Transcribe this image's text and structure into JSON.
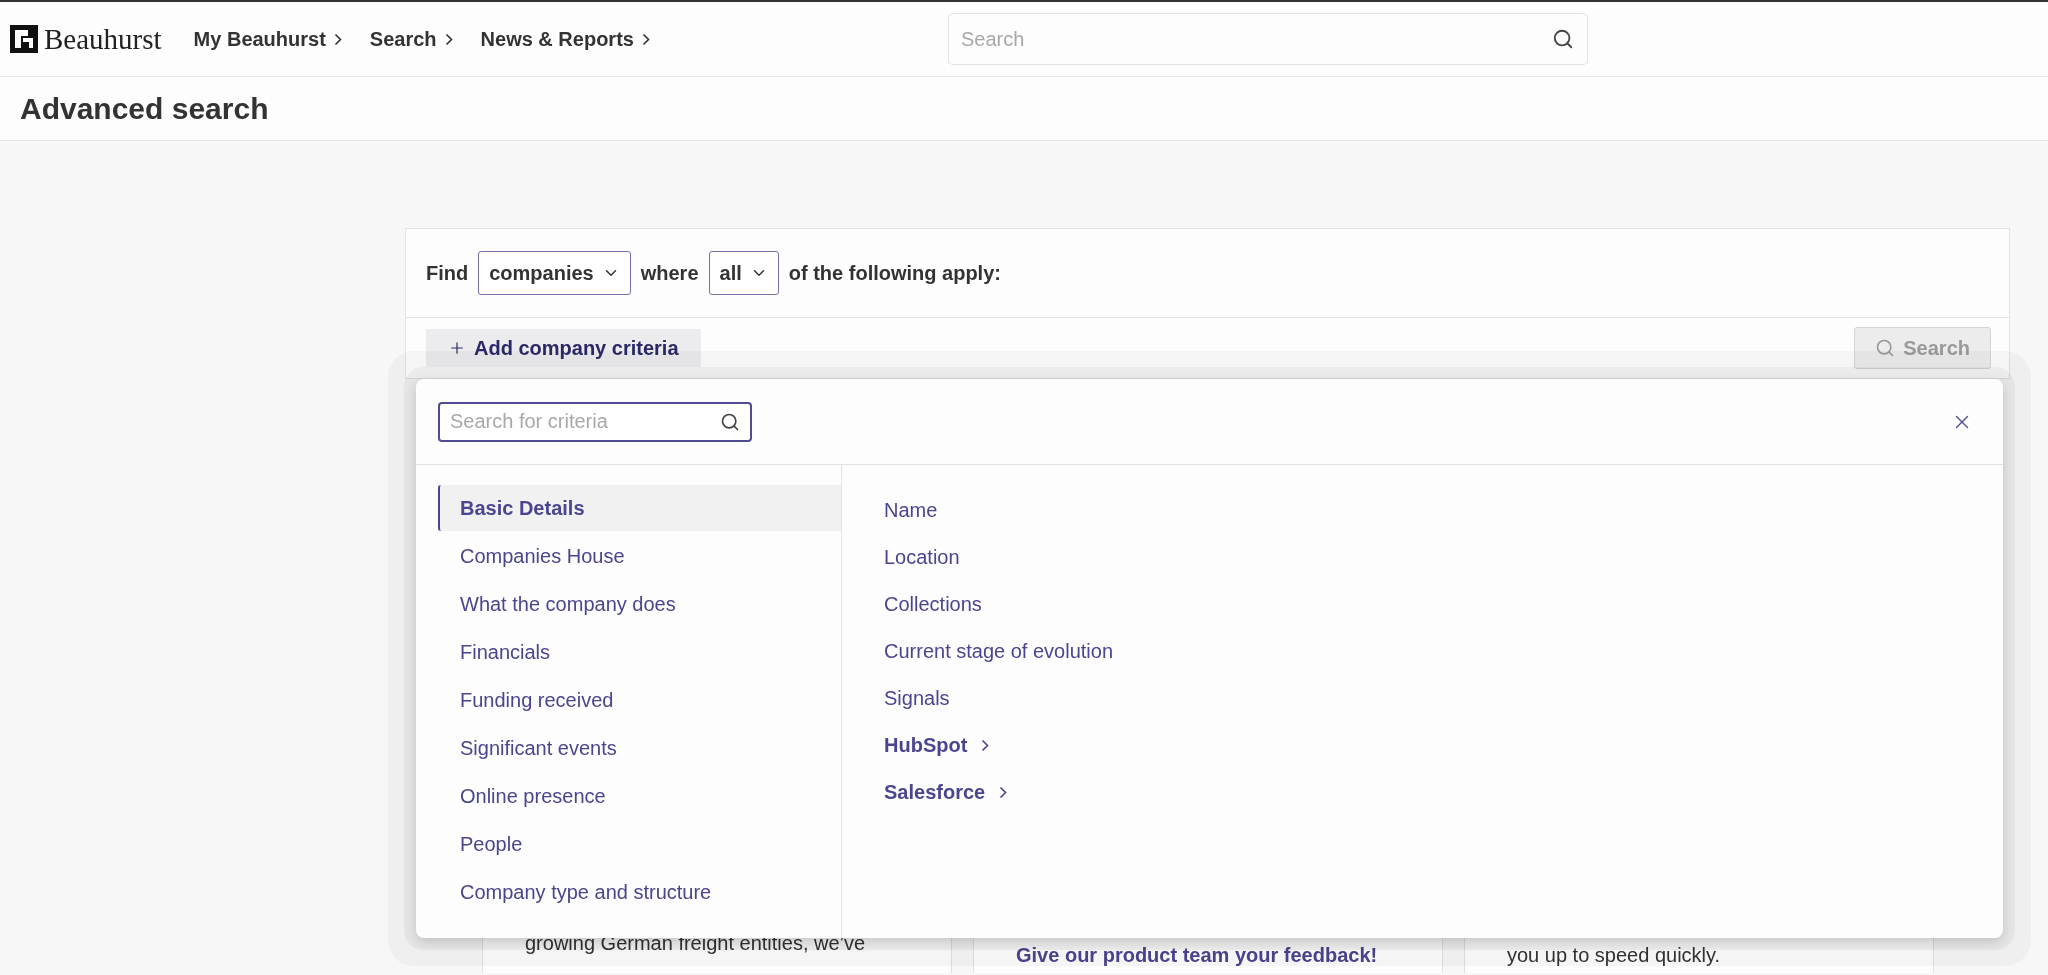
{
  "header": {
    "logo": "Beauhurst",
    "nav": [
      {
        "label": "My Beauhurst"
      },
      {
        "label": "Search"
      },
      {
        "label": "News & Reports"
      }
    ],
    "search": {
      "placeholder": "Search"
    }
  },
  "page_title": "Advanced search",
  "query": {
    "find_label": "Find",
    "entity_select": "companies",
    "where_label": "where",
    "match_select": "all",
    "suffix": "of the following apply:"
  },
  "add_criteria_button": "Add company criteria",
  "search_button": {
    "label": "Search",
    "disabled": true
  },
  "criteria_popup": {
    "search": {
      "placeholder": "Search for criteria"
    },
    "categories": [
      {
        "label": "Basic Details",
        "selected": true
      },
      {
        "label": "Companies House",
        "selected": false
      },
      {
        "label": "What the company does",
        "selected": false
      },
      {
        "label": "Financials",
        "selected": false
      },
      {
        "label": "Funding received",
        "selected": false
      },
      {
        "label": "Significant events",
        "selected": false
      },
      {
        "label": "Online presence",
        "selected": false
      },
      {
        "label": "People",
        "selected": false
      },
      {
        "label": "Company type and structure",
        "selected": false
      }
    ],
    "criteria": [
      {
        "label": "Name",
        "kind": "item"
      },
      {
        "label": "Location",
        "kind": "item"
      },
      {
        "label": "Collections",
        "kind": "item"
      },
      {
        "label": "Current stage of evolution",
        "kind": "item"
      },
      {
        "label": "Signals",
        "kind": "item"
      },
      {
        "label": "HubSpot",
        "kind": "group"
      },
      {
        "label": "Salesforce",
        "kind": "group"
      }
    ]
  },
  "cards": [
    {
      "text": "growing German freight entities, we’ve",
      "kind": "text"
    },
    {
      "text": "Give our product team your feedback!",
      "kind": "link"
    },
    {
      "text": "you up to speed quickly.",
      "kind": "text"
    }
  ]
}
